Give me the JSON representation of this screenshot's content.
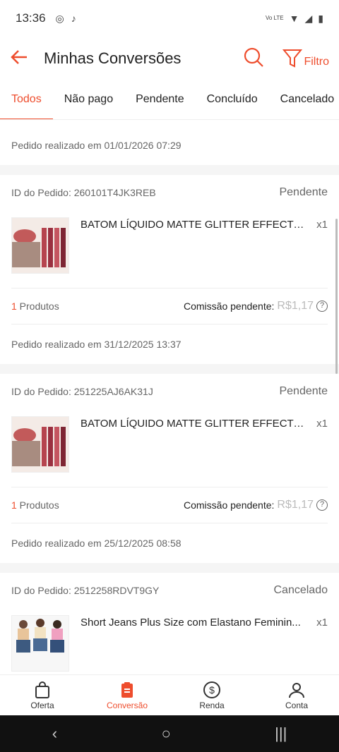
{
  "statusbar": {
    "time": "13:36",
    "volte": "Vo LTE"
  },
  "appbar": {
    "title": "Minhas Conversões",
    "filter_label": "Filtro"
  },
  "tabs": [
    "Todos",
    "Não pago",
    "Pendente",
    "Concluído",
    "Cancelado"
  ],
  "top_date": "Pedido realizado em 01/01/2026 07:29",
  "orders": [
    {
      "id": "ID do Pedido: 260101T4JK3REB",
      "status": "Pendente",
      "product": "BATOM LÍQUIDO MATTE GLITTER  EFFECT P...",
      "qty": "x1",
      "count_num": "1",
      "count_label": " Produtos",
      "commission_label": "Comissão pendente:",
      "commission_value": "R$1,17",
      "date": "Pedido realizado em 31/12/2025 13:37"
    },
    {
      "id": "ID do Pedido: 251225AJ6AK31J",
      "status": "Pendente",
      "product": "BATOM LÍQUIDO MATTE GLITTER  EFFECT P...",
      "qty": "x1",
      "count_num": "1",
      "count_label": " Produtos",
      "commission_label": "Comissão pendente:",
      "commission_value": "R$1,17",
      "date": "Pedido realizado em 25/12/2025 08:58"
    },
    {
      "id": "ID do Pedido: 2512258RDVT9GY",
      "status": "Cancelado",
      "product": "Short Jeans Plus Size com Elastano Feminin...",
      "qty": "x1"
    }
  ],
  "bottomnav": [
    "Oferta",
    "Conversão",
    "Renda",
    "Conta"
  ],
  "colors": {
    "accent": "#ee4d2d"
  }
}
